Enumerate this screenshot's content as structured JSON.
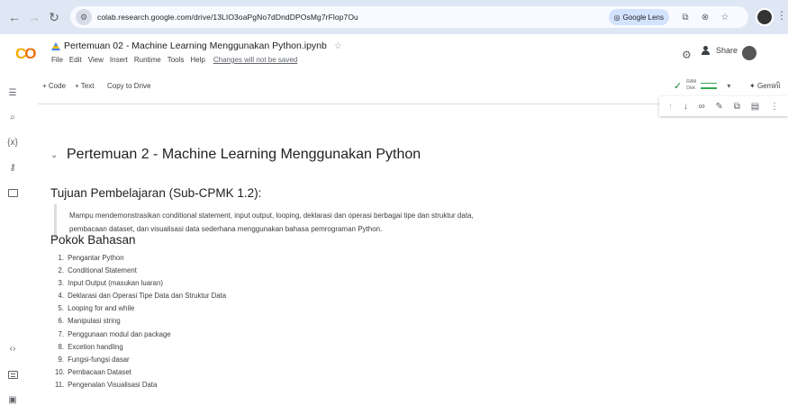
{
  "browser": {
    "url": "colab.research.google.com/drive/13LIO3oaPgNo7dDndDPOsMg7rFlop7Ou",
    "lens_label": "Google Lens"
  },
  "colab": {
    "notebook_title": "Pertemuan 02 - Machine Learning Menggunakan Python.ipynb",
    "menu": [
      "File",
      "Edit",
      "View",
      "Insert",
      "Runtime",
      "Tools",
      "Help"
    ],
    "changes_text": "Changes will not be saved",
    "share_label": "Share"
  },
  "toolbar": {
    "code_label": "+ Code",
    "text_label": "+ Text",
    "copy_label": "Copy to Drive",
    "ram_label": "RAM",
    "disk_label": "Disk",
    "gemini_label": "Gemini"
  },
  "notebook": {
    "section_title": "Pertemuan 2 - Machine Learning Menggunakan Python",
    "goal_heading": "Tujuan Pembelajaran (Sub-CPMK 1.2):",
    "goal_line1": "Mampu mendemonstrasikan conditional statement, input output, looping, deklarasi dan operasi berbagai tipe dan struktur data,",
    "goal_line2": "pembacaan dataset, dan visualisasi data sederhana menggunakan bahasa pemrograman Python.",
    "topics_heading": "Pokok Bahasan",
    "topics": [
      {
        "num": "1.",
        "text": "Pengantar Python"
      },
      {
        "num": "2.",
        "text": "Conditional Statement"
      },
      {
        "num": "3.",
        "text": "Input Output (masukan luaran)"
      },
      {
        "num": "4.",
        "text": "Deklarasi dan Operasi Tipe Data dan Struktur Data"
      },
      {
        "num": "5.",
        "text": "Looping for and while"
      },
      {
        "num": "6.",
        "text": "Manipulasi string"
      },
      {
        "num": "7.",
        "text": "Penggunaan modul dan package"
      },
      {
        "num": "8.",
        "text": "Excetion handling"
      },
      {
        "num": "9.",
        "text": "Fungsi-fungsi dasar"
      },
      {
        "num": "10.",
        "text": "Pembacaan Dataset"
      },
      {
        "num": "11.",
        "text": "Pengenalan Visualisasi Data"
      }
    ]
  }
}
